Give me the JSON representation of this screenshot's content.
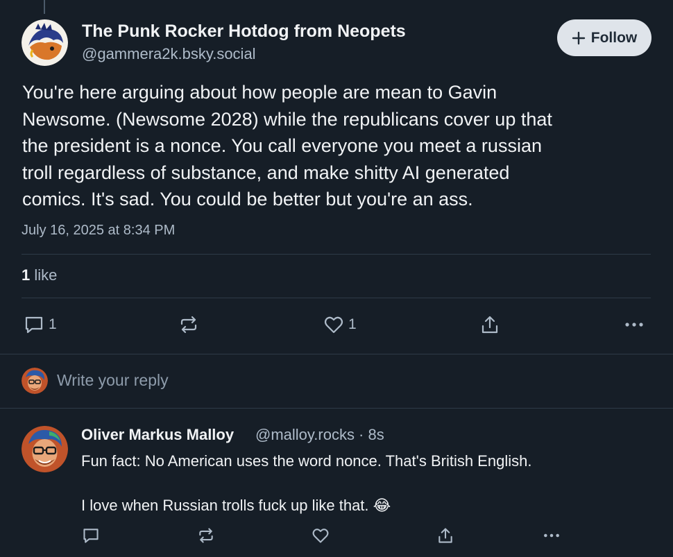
{
  "post": {
    "author_name": "The Punk Rocker Hotdog from Neopets",
    "author_handle": "@gammera2k.bsky.social",
    "follow_label": "Follow",
    "text_lines": [
      "You're here arguing about how people are mean to Gavin",
      "Newsome. (Newsome 2028) while the republicans cover up that",
      "the president is a nonce.  You call everyone you meet a russian",
      "troll regardless of substance, and make shitty AI generated",
      "comics.  It's sad.  You could be better but you're an ass."
    ],
    "timestamp": "July 16, 2025 at 8:34 PM",
    "like_count": "1",
    "like_word": "like",
    "actions": {
      "reply_count": "1",
      "like_count": "1"
    }
  },
  "reply_composer": {
    "placeholder": "Write your reply"
  },
  "comment": {
    "author_name": "Oliver Markus Malloy",
    "author_handle": "@malloy.rocks · 8s",
    "lines": [
      "Fun fact: No American uses the word nonce. That's British English.",
      "",
      "I love when Russian trolls fuck up like that. 😂"
    ]
  },
  "colors": {
    "background": "#161e27",
    "text": "#f1f3f5",
    "muted": "#aebbc9",
    "divider": "#2e3b48",
    "follow_bg": "#dfe4ea"
  },
  "icons": [
    "plus-icon",
    "reply-icon",
    "repost-icon",
    "heart-icon",
    "share-icon",
    "more-icon"
  ]
}
